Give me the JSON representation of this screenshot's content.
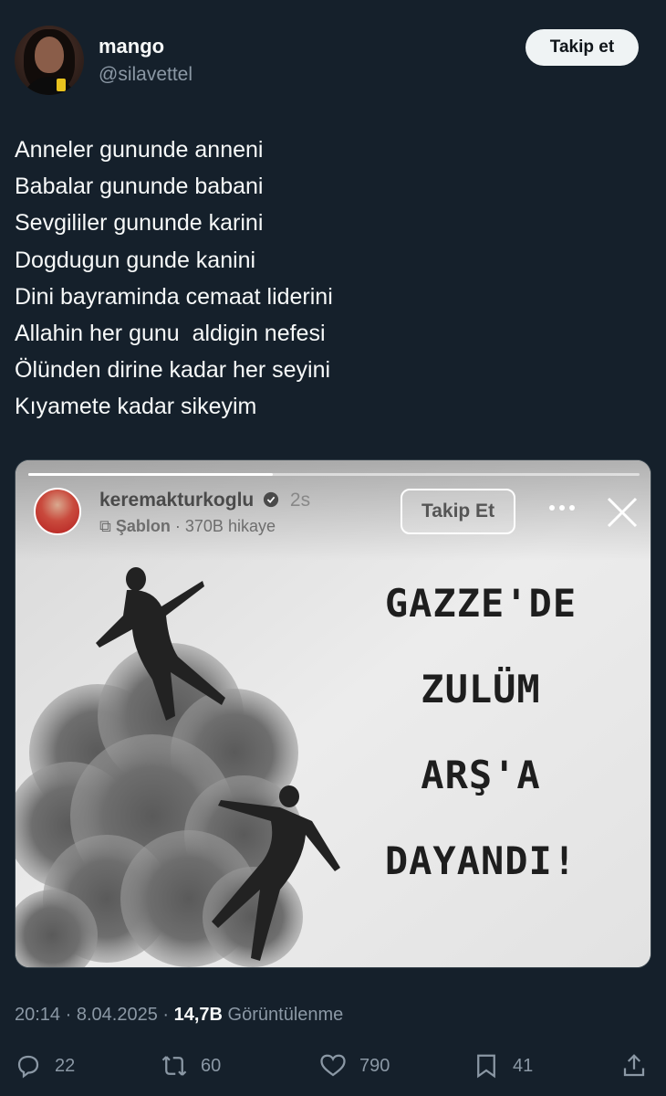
{
  "author": {
    "name": "mango",
    "handle": "@silavettel",
    "follow_label": "Takip et"
  },
  "tweet": {
    "lines": [
      "Anneler gununde anneni",
      "Babalar gununde babani",
      "Sevgililer gununde karini",
      "Dogdugun gunde kanini",
      "Dini bayraminda cemaat liderini",
      "Allahin her gunu  aldigin nefesi",
      "Ölünden dirine kadar her seyini",
      "Kıyamete kadar sikeyim"
    ]
  },
  "story": {
    "username": "keremakturkoglu",
    "time": "2s",
    "template_label": "Şablon",
    "story_count": "· 370B hikaye",
    "follow_label": "Takip Et",
    "headline_lines": [
      "GAZZE'DE",
      "ZULÜM",
      "ARŞ'A",
      "DAYANDI!"
    ],
    "progress": 0.4
  },
  "meta": {
    "time": "20:14",
    "date": "8.04.2025",
    "views": "14,7B",
    "views_label": "Görüntülenme"
  },
  "actions": {
    "replies": "22",
    "reposts": "60",
    "likes": "790",
    "bookmarks": "41"
  },
  "colors": {
    "background": "#15202b",
    "text": "#f7f9f9",
    "muted": "#8b98a5"
  }
}
